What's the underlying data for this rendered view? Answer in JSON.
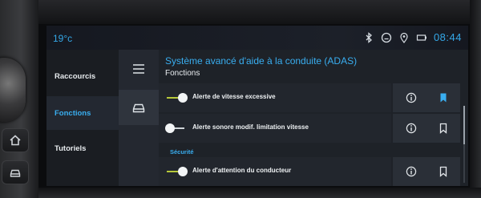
{
  "status_bar": {
    "temperature": "19°c",
    "clock": "08:44",
    "icons": [
      "bluetooth-icon",
      "speed-limit-sign-icon",
      "location-pin-icon",
      "battery-icon"
    ]
  },
  "side_menu": {
    "items": [
      {
        "label": "Raccourcis",
        "active": false
      },
      {
        "label": "Fonctions",
        "active": true
      },
      {
        "label": "Tutoriels",
        "active": false
      }
    ]
  },
  "rail": {
    "items": [
      "hamburger-menu-icon",
      "car-icon"
    ]
  },
  "content": {
    "title": "Système avancé d'aide à la conduite (ADAS)",
    "subtitle": "Fonctions",
    "section_label": "Sécurité",
    "rows": [
      {
        "label": "Alerte de vitesse excessive",
        "toggle_on": true,
        "bookmarked": true
      },
      {
        "label": "Alerte sonore modif. limitation vitesse",
        "toggle_on": false,
        "bookmarked": false
      },
      {
        "label": "Alerte d'attention du conducteur",
        "toggle_on": true,
        "bookmarked": false
      }
    ]
  },
  "hardware_buttons": [
    "home-icon",
    "car-icon"
  ],
  "colors": {
    "accent": "#39aef0",
    "toggle_on": "#b7c93a",
    "bookmark_active": "#39aef0",
    "screen_bg": "#1d2126"
  }
}
